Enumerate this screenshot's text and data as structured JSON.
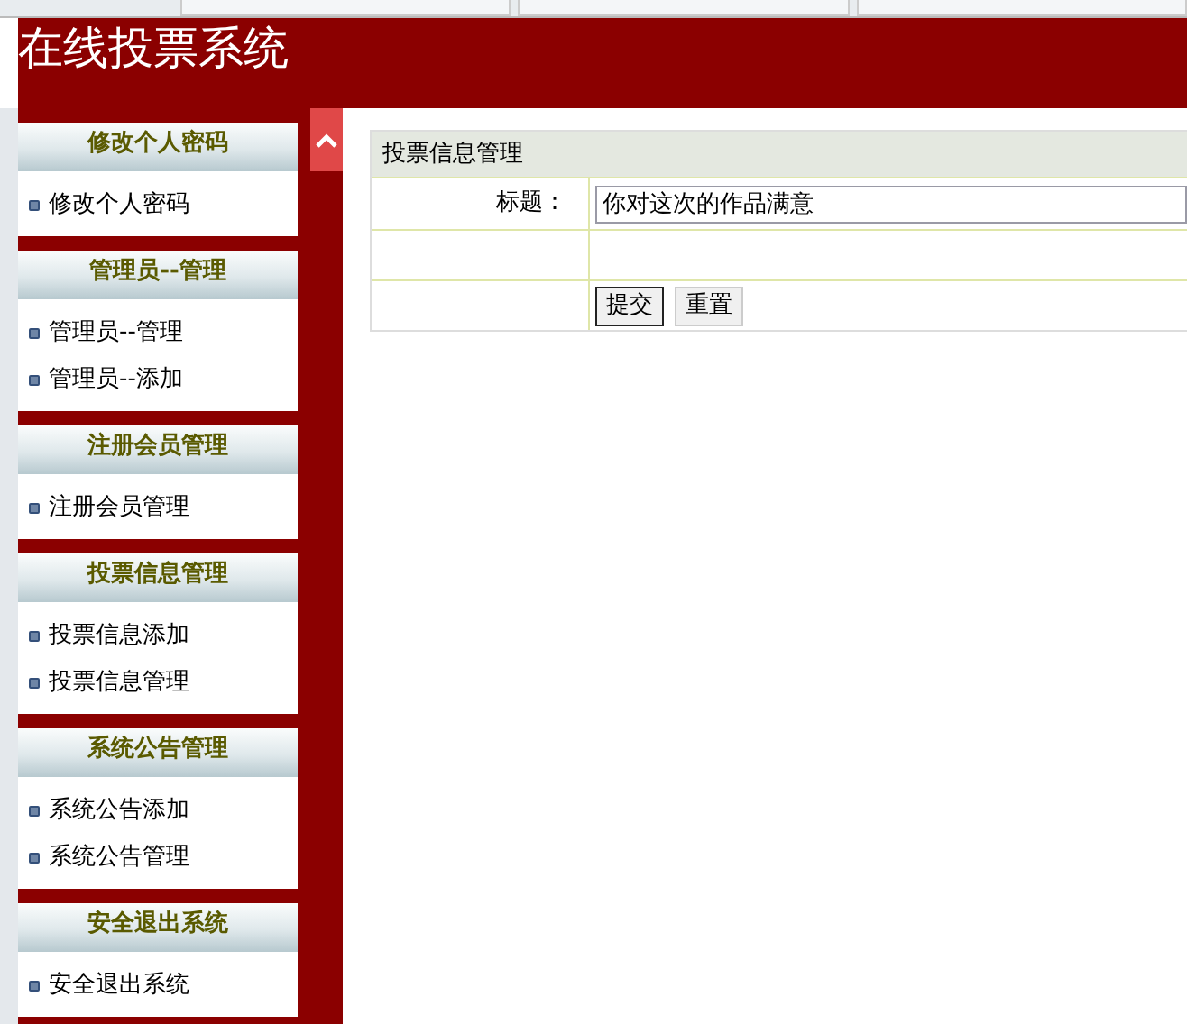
{
  "header": {
    "title": "在线投票系统"
  },
  "sidebar": {
    "sections": [
      {
        "title": "修改个人密码",
        "items": [
          "修改个人密码"
        ]
      },
      {
        "title": "管理员--管理",
        "items": [
          "管理员--管理",
          "管理员--添加"
        ]
      },
      {
        "title": "注册会员管理",
        "items": [
          "注册会员管理"
        ]
      },
      {
        "title": "投票信息管理",
        "items": [
          "投票信息添加",
          "投票信息管理"
        ]
      },
      {
        "title": "系统公告管理",
        "items": [
          "系统公告添加",
          "系统公告管理"
        ]
      },
      {
        "title": "安全退出系统",
        "items": [
          "安全退出系统"
        ]
      }
    ]
  },
  "form": {
    "title": "投票信息管理",
    "rows": [
      {
        "kind": "field",
        "label": "标题：",
        "value": "你对这次的作品满意"
      },
      {
        "kind": "blank"
      },
      {
        "kind": "buttons",
        "buttons": [
          {
            "label": "提交",
            "default": true
          },
          {
            "label": "重置",
            "default": false
          }
        ]
      }
    ]
  }
}
